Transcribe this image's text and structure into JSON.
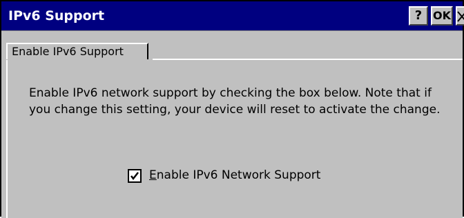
{
  "window": {
    "title": "IPv6 Support",
    "help_label": "?",
    "ok_label": "OK",
    "close_icon": "close-icon"
  },
  "tabs": [
    {
      "label": "Enable IPv6 Support",
      "selected": true
    }
  ],
  "content": {
    "description": "Enable IPv6 network support by checking the box below.  Note that if you change this setting, your device will reset to activate the change.",
    "checkbox": {
      "label_mnemonic": "E",
      "label_rest": "nable IPv6 Network Support",
      "checked": true
    }
  },
  "colors": {
    "titlebar": "#000080",
    "face": "#c0c0c0"
  }
}
